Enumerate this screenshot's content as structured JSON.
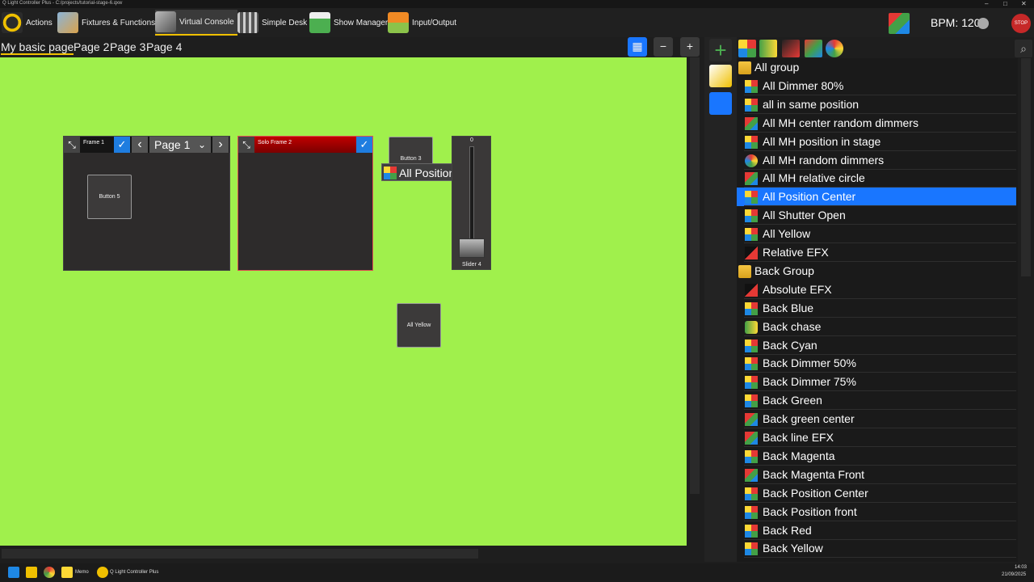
{
  "window": {
    "title": "Q Light Controller Plus - C:/projects/tutorial-stage-6.qxw",
    "controls": [
      "–",
      "□",
      "✕"
    ]
  },
  "toolbar": {
    "items": [
      {
        "label": "Actions",
        "icon": "qlc-logo-icon"
      },
      {
        "label": "Fixtures & Functions",
        "icon": "fixtures-icon"
      },
      {
        "label": "Virtual Console",
        "icon": "virtual-console-icon",
        "active": true
      },
      {
        "label": "Simple Desk",
        "icon": "simple-desk-icon"
      },
      {
        "label": "Show Manager",
        "icon": "show-manager-icon"
      },
      {
        "label": "Input/Output",
        "icon": "input-output-icon"
      }
    ],
    "bpm_label": "BPM: 120",
    "stop_label": "STOP"
  },
  "pages": {
    "tabs": [
      "My basic page",
      "Page 2",
      "Page 3",
      "Page 4"
    ],
    "active_index": 0
  },
  "view_controls": {
    "grid": "▦",
    "zoom_out": "−",
    "zoom_in": "+"
  },
  "console": {
    "background": "#a0f04c",
    "frame1": {
      "title": "Frame 1",
      "page_label": "Page 1",
      "prev": "‹",
      "next": "›",
      "dropdown": "⌄",
      "button": "Button 5"
    },
    "solo_frame": {
      "title": "Solo Frame 2"
    },
    "button3": "Button 3",
    "drag_tooltip": "All Position Cente",
    "slider": {
      "value": "0",
      "label": "Slider 4"
    },
    "all_yellow": "All Yellow"
  },
  "functions": {
    "tree": [
      {
        "label": "All group",
        "type": "folder",
        "level": 0
      },
      {
        "label": "All Dimmer 80%",
        "type": "scene",
        "level": 1
      },
      {
        "label": "all in same position",
        "type": "scene",
        "level": 1
      },
      {
        "label": "All MH center random dimmers",
        "type": "collection",
        "level": 1
      },
      {
        "label": "All MH position in stage",
        "type": "scene",
        "level": 1
      },
      {
        "label": "All MH random dimmers",
        "type": "rgbmatrix",
        "level": 1
      },
      {
        "label": "All MH relative circle",
        "type": "collection",
        "level": 1
      },
      {
        "label": "All Position Center",
        "type": "scene",
        "level": 1,
        "selected": true
      },
      {
        "label": "All Shutter Open",
        "type": "scene",
        "level": 1
      },
      {
        "label": "All Yellow",
        "type": "scene",
        "level": 1
      },
      {
        "label": "Relative EFX",
        "type": "efx",
        "level": 1
      },
      {
        "label": "Back Group",
        "type": "folder",
        "level": 0
      },
      {
        "label": "Absolute EFX",
        "type": "efx",
        "level": 1
      },
      {
        "label": "Back Blue",
        "type": "scene",
        "level": 1
      },
      {
        "label": "Back chase",
        "type": "chaser",
        "level": 1
      },
      {
        "label": "Back Cyan",
        "type": "scene",
        "level": 1
      },
      {
        "label": "Back Dimmer 50%",
        "type": "scene",
        "level": 1
      },
      {
        "label": "Back Dimmer 75%",
        "type": "scene",
        "level": 1
      },
      {
        "label": "Back Green",
        "type": "scene",
        "level": 1
      },
      {
        "label": "Back green center",
        "type": "collection",
        "level": 1
      },
      {
        "label": "Back line EFX",
        "type": "collection",
        "level": 1
      },
      {
        "label": "Back Magenta",
        "type": "scene",
        "level": 1
      },
      {
        "label": "Back Magenta Front",
        "type": "collection",
        "level": 1
      },
      {
        "label": "Back Position Center",
        "type": "scene",
        "level": 1
      },
      {
        "label": "Back Position front",
        "type": "scene",
        "level": 1
      },
      {
        "label": "Back Red",
        "type": "scene",
        "level": 1
      },
      {
        "label": "Back Yellow",
        "type": "scene",
        "level": 1
      }
    ]
  },
  "taskbar": {
    "items": [
      "Memo",
      "Q Light Controller Plus"
    ],
    "time": "14:03",
    "date": "21/09/2025"
  },
  "colors": {
    "accent": "#f0c000",
    "selection": "#1976ff",
    "check_blue": "#1e7de0",
    "solo_red": "#b00000"
  }
}
